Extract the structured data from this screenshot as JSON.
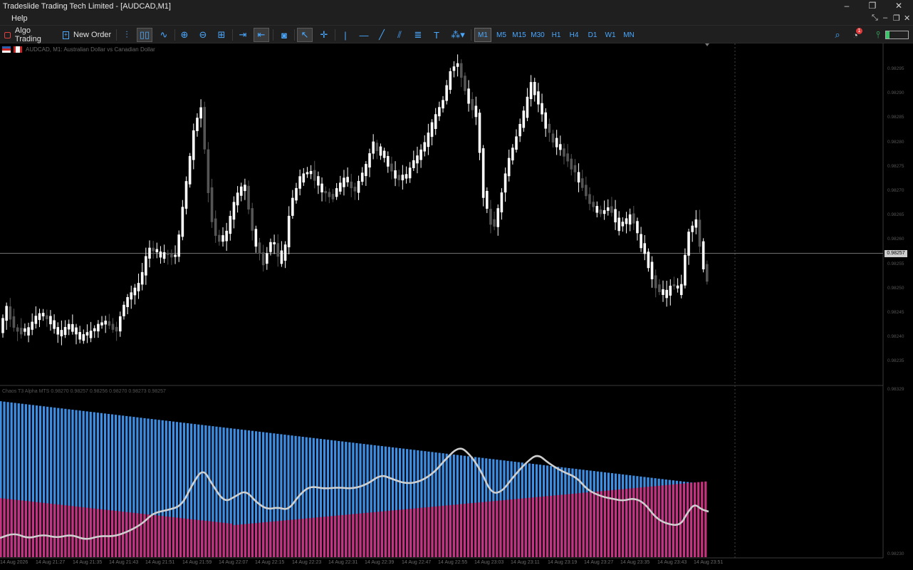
{
  "window": {
    "title": "Tradeslide Trading Tech Limited - [AUDCAD,M1]",
    "controls": [
      "–",
      "❐",
      "✕"
    ]
  },
  "menu": {
    "help": "Help"
  },
  "toolbar": {
    "algo_trading": "Algo Trading",
    "new_order": "New Order",
    "timeframes": [
      "M1",
      "M5",
      "M15",
      "M30",
      "H1",
      "H4",
      "D1",
      "W1",
      "MN"
    ],
    "active_timeframe": "M1",
    "notification_count": "1"
  },
  "chart": {
    "symbol_label": "AUDCAD, M1:  Australian Dollar vs Canadian Dollar",
    "current_price": "0.98257",
    "indicator_label": "Chaos T3 Alpha MTS 0.98270 0.98257 0.98256 0.98270 0.98273 0.98257",
    "price_labels": [
      "0.98295",
      "0.98290",
      "0.98285",
      "0.98280",
      "0.98275",
      "0.98270",
      "0.98265",
      "0.98260",
      "0.98255",
      "0.98250",
      "0.98245",
      "0.98240",
      "0.98235"
    ],
    "indicator_price_labels": [
      "0.98329",
      "0.98230"
    ],
    "time_labels": [
      "14 Aug 2026",
      "14 Aug 21:27",
      "14 Aug 21:35",
      "14 Aug 21:43",
      "14 Aug 21:51",
      "14 Aug 21:59",
      "14 Aug 22:07",
      "14 Aug 22:15",
      "14 Aug 22:23",
      "14 Aug 22:31",
      "14 Aug 22:39",
      "14 Aug 22:47",
      "14 Aug 22:55",
      "14 Aug 23:03",
      "14 Aug 23:11",
      "14 Aug 23:19",
      "14 Aug 23:27",
      "14 Aug 23:35",
      "14 Aug 23:43",
      "14 Aug 23:51"
    ],
    "colors": {
      "bull": "#ffffff",
      "bear": "#555555",
      "blue_hist": "#3d8fe6",
      "magenta_hist": "#c8317f",
      "signal_line": "#cfcfcf"
    }
  }
}
